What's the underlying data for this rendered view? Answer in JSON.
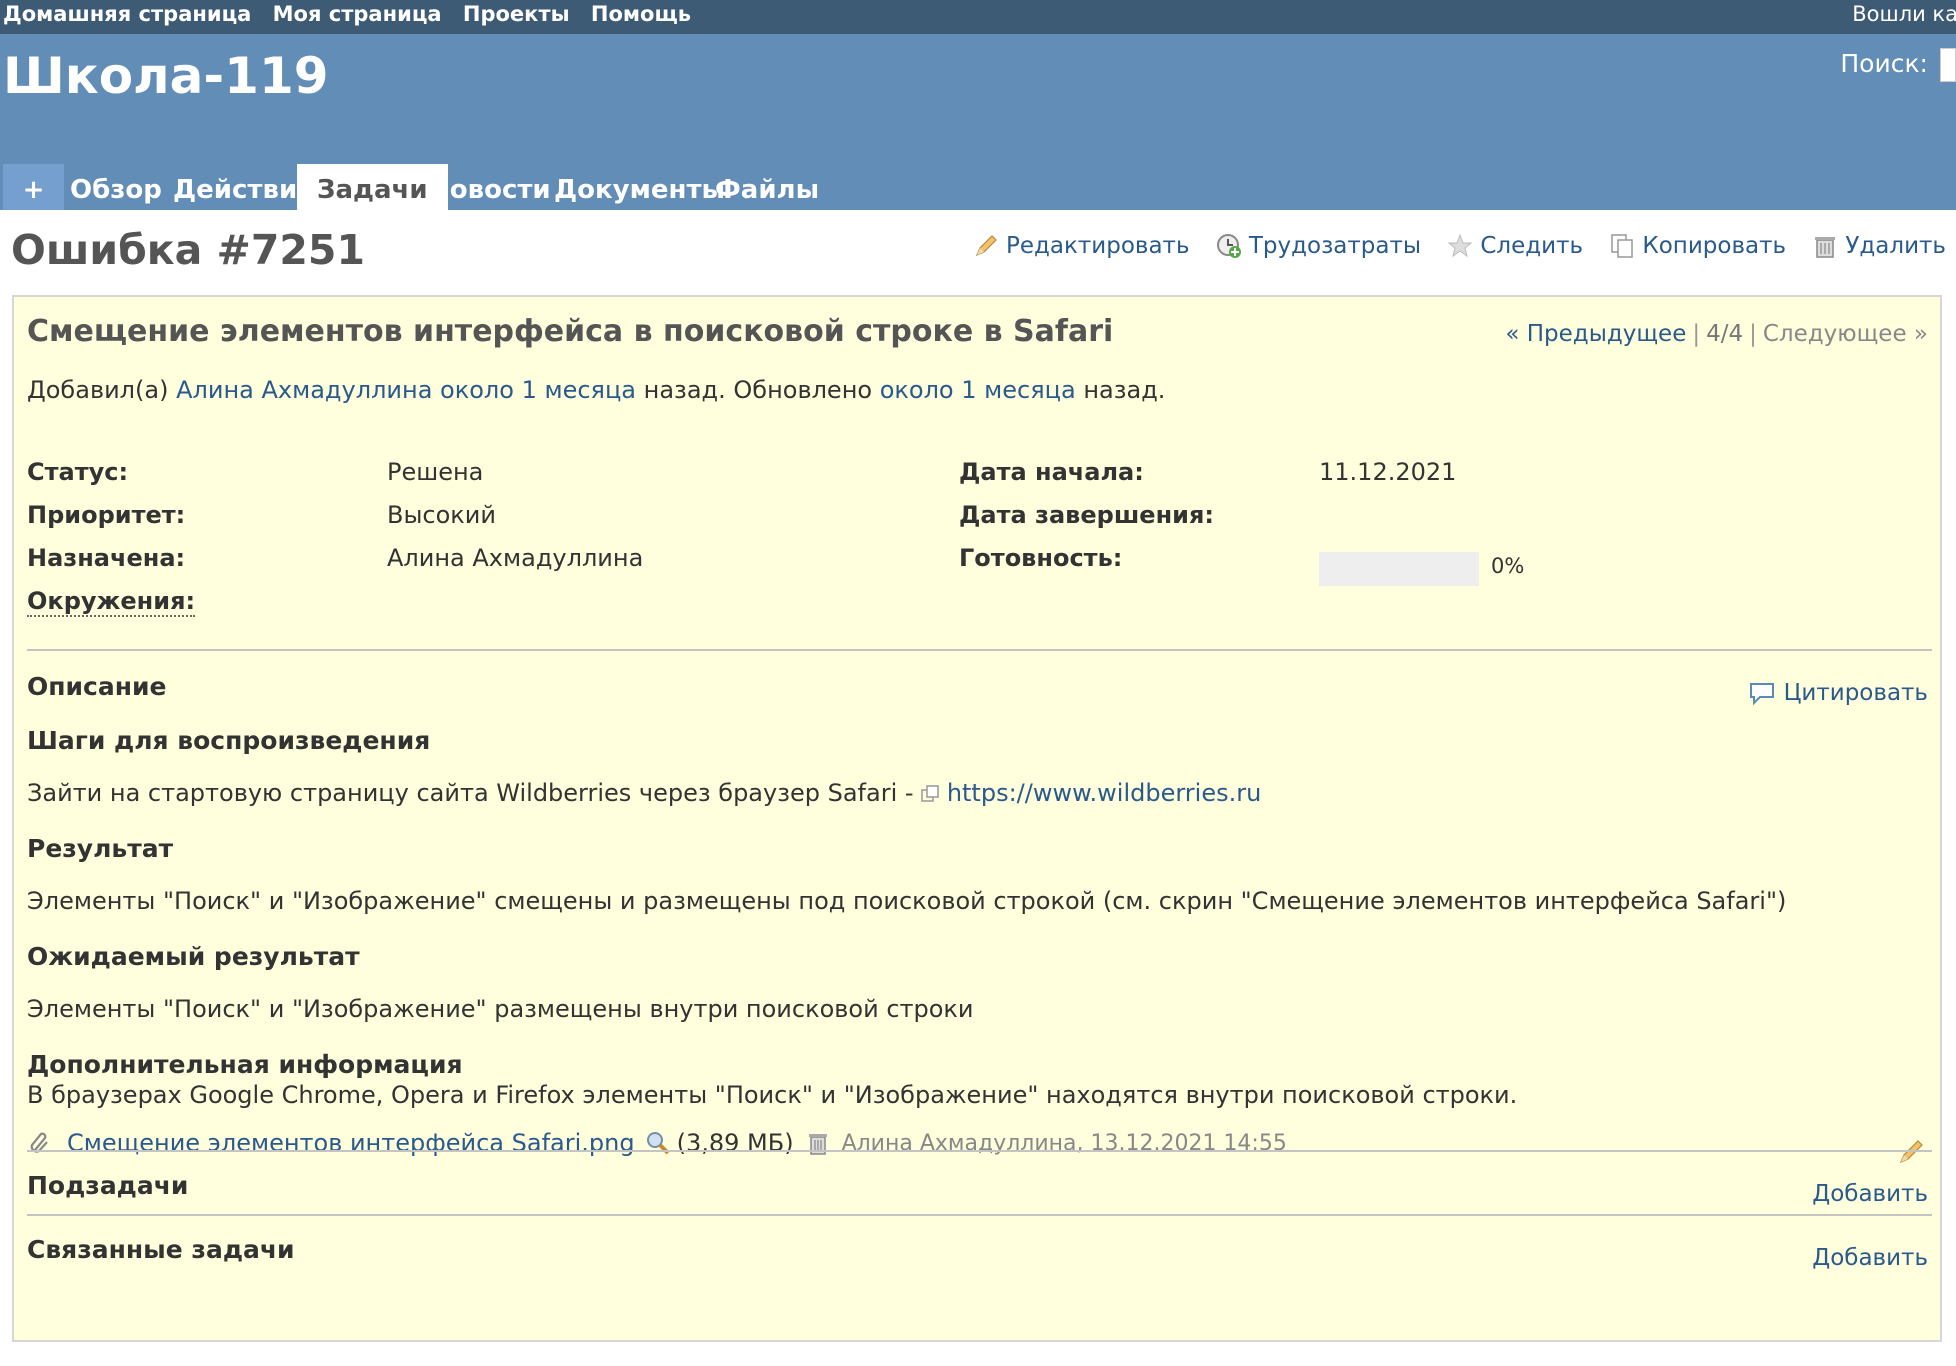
{
  "top_menu": {
    "home": "Домашняя страница",
    "my_page": "Моя страница",
    "projects": "Проекты",
    "help": "Помощь",
    "logged_as": "Вошли ка"
  },
  "header": {
    "project_title": "Школа-119",
    "search_label": "Поиск:"
  },
  "tabs": {
    "plus": "+",
    "overview": "Обзор",
    "activity": "Действия",
    "issues": "Задачи",
    "news": "Новости",
    "documents": "Документы",
    "files": "Файлы"
  },
  "issue": {
    "heading": "Ошибка #7251",
    "actions": {
      "edit": "Редактировать",
      "time": "Трудозатраты",
      "watch": "Следить",
      "copy": "Копировать",
      "delete": "Удалить"
    },
    "subject": "Смещение элементов интерфейса в поисковой строке в Safari",
    "nav": {
      "prev": "« Предыдущее",
      "count": "4/4",
      "next": "Следующее »"
    },
    "author_line": {
      "added_by": "Добавил(а)",
      "author": "Алина Ахмадуллина",
      "created_ago": "около 1 месяца",
      "ago_updated": "назад. Обновлено",
      "updated_ago": "около 1 месяца",
      "ago": "назад."
    },
    "attributes": {
      "status_label": "Статус:",
      "status": "Решена",
      "priority_label": "Приоритет:",
      "priority": "Высокий",
      "assignee_label": "Назначена:",
      "assignee": "Алина Ахмадуллина",
      "environment_label": "Окружения:",
      "start_date_label": "Дата начала:",
      "start_date": "11.12.2021",
      "due_date_label": "Дата завершения:",
      "done_label": "Готовность:",
      "done_ratio": 0,
      "done_text": "0%"
    },
    "description": {
      "title": "Описание",
      "quote": "Цитировать",
      "steps_title": "Шаги для воспроизведения",
      "steps_text": "Зайти на стартовую страницу сайта Wildberries через браузер Safari -",
      "steps_link": "https://www.wildberries.ru",
      "result_title": "Результат",
      "result_text": "Элементы \"Поиск\" и \"Изображение\" смещены и размещены под поисковой строкой (см. скрин \"Смещение элементов интерфейса Safari\")",
      "expected_title": "Ожидаемый результат",
      "expected_text": "Элементы \"Поиск\" и \"Изображение\" размещены внутри поисковой строки",
      "extra_title": "Дополнительная информация",
      "extra_text": "В браузерах Google Chrome, Opera и Firefox элементы \"Поиск\" и \"Изображение\" находятся внутри поисковой строки."
    },
    "attachment": {
      "filename": "Смещение элементов интерфейса Safari.png",
      "size": "(3,89 МБ)",
      "meta": "Алина Ахмадуллина, 13.12.2021 14:55"
    },
    "subtasks": {
      "title": "Подзадачи",
      "add": "Добавить"
    },
    "relations": {
      "title": "Связанные задачи",
      "add": "Добавить"
    }
  },
  "colors": {
    "top_menu_bg": "#3e5b76",
    "header_bg": "#628db6",
    "issue_bg": "#ffffdd",
    "link": "#2a5a8c"
  }
}
